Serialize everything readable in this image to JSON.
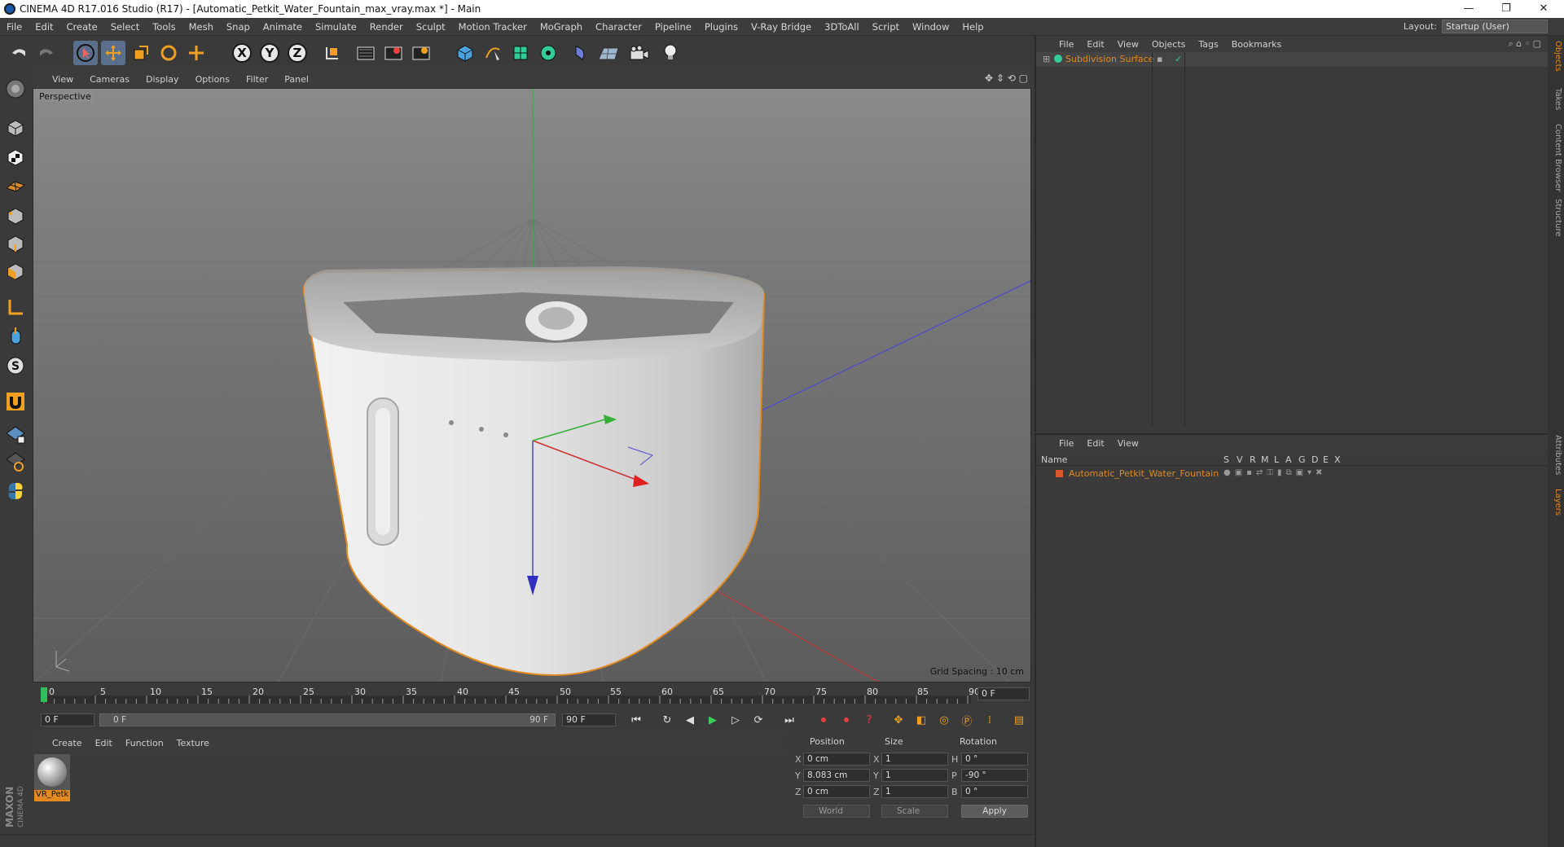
{
  "window": {
    "title": "CINEMA 4D R17.016 Studio (R17) - [Automatic_Petkit_Water_Fountain_max_vray.max *] - Main",
    "minimize": "—",
    "maximize": "❐",
    "close": "✕"
  },
  "menubar": {
    "items": [
      "File",
      "Edit",
      "Create",
      "Select",
      "Tools",
      "Mesh",
      "Snap",
      "Animate",
      "Simulate",
      "Render",
      "Sculpt",
      "Motion Tracker",
      "MoGraph",
      "Character",
      "Pipeline",
      "Plugins",
      "V-Ray Bridge",
      "3DToAll",
      "Script",
      "Window",
      "Help"
    ],
    "layout_label": "Layout:",
    "layout_value": "Startup (User)"
  },
  "viewport": {
    "menu": [
      "View",
      "Cameras",
      "Display",
      "Options",
      "Filter",
      "Panel"
    ],
    "label": "Perspective",
    "grid_spacing": "Grid Spacing : 10 cm"
  },
  "timeline": {
    "ticks": [
      "0",
      "5",
      "10",
      "15",
      "20",
      "25",
      "30",
      "35",
      "40",
      "45",
      "50",
      "55",
      "60",
      "65",
      "70",
      "75",
      "80",
      "85",
      "90"
    ],
    "current_frame": "0 F",
    "start_field": "0 F",
    "range_start": "0 F",
    "range_end": "90 F",
    "end_field": "90 F"
  },
  "materials": {
    "menu": [
      "Create",
      "Edit",
      "Function",
      "Texture"
    ],
    "items": [
      {
        "name": "VR_Petk"
      }
    ]
  },
  "coordinates": {
    "headers": {
      "position": "Position",
      "size": "Size",
      "rotation": "Rotation"
    },
    "rows": [
      {
        "axis": "X",
        "pos": "0 cm",
        "size_axis": "X",
        "size": "1",
        "rot_axis": "H",
        "rot": "0 °"
      },
      {
        "axis": "Y",
        "pos": "8.083 cm",
        "size_axis": "Y",
        "size": "1",
        "rot_axis": "P",
        "rot": "-90 °"
      },
      {
        "axis": "Z",
        "pos": "0 cm",
        "size_axis": "Z",
        "size": "1",
        "rot_axis": "B",
        "rot": "0 °"
      }
    ],
    "mode_world": "World",
    "mode_scale": "Scale",
    "apply": "Apply"
  },
  "objects_panel": {
    "menu": [
      "File",
      "Edit",
      "View",
      "Objects",
      "Tags",
      "Bookmarks"
    ],
    "items": [
      {
        "name": "Subdivision Surface"
      }
    ]
  },
  "layers_panel": {
    "menu": [
      "File",
      "Edit",
      "View"
    ],
    "columns": [
      "Name",
      "S",
      "V",
      "R",
      "M",
      "L",
      "A",
      "G",
      "D",
      "E",
      "X"
    ],
    "rows": [
      {
        "name": "Automatic_Petkit_Water_Fountain"
      }
    ]
  },
  "side_tabs": [
    "Objects",
    "Takes",
    "Content Browser",
    "Structure",
    "Attributes",
    "Layers"
  ],
  "brand": "MAXON CINEMA 4D",
  "colors": {
    "accent_orange": "#e2891f",
    "selected_blue": "#5a6f8c",
    "viewport_bg": "#6e6e6e"
  }
}
